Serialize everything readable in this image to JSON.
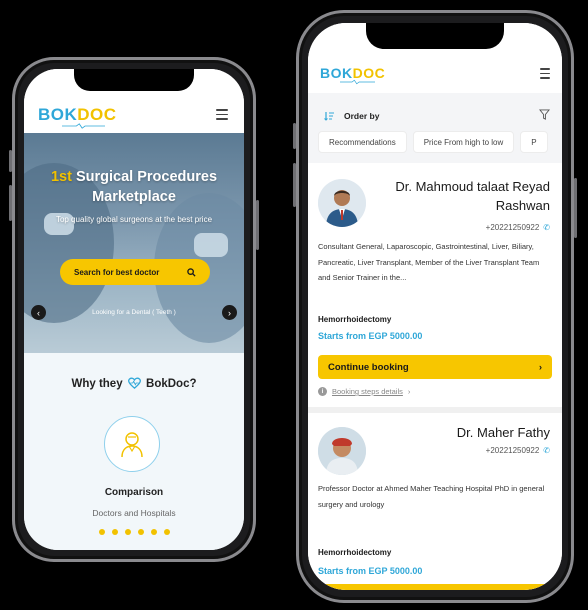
{
  "brand": {
    "part1": "BOK",
    "part2": "DOC",
    "primary_color": "#2fa7d8",
    "accent_color": "#f2c200"
  },
  "left_screen": {
    "hero": {
      "title_accent": "1st",
      "title_line1_rest": " Surgical Procedures",
      "title_line2": "Marketplace",
      "subtitle": "Top quality global surgeons at the best price",
      "search_button": "Search for best doctor",
      "footer_text": "Looking for a Dental ( Teeth )"
    },
    "why": {
      "title_prefix": "Why they",
      "title_brand": "BokDoc?",
      "feature_title": "Comparison",
      "feature_subtitle": "Doctors and Hospitals",
      "carousel_dots": 6
    }
  },
  "right_screen": {
    "order_label": "Order by",
    "chips": [
      "Recommendations",
      "Price From high to low",
      "P"
    ],
    "doctors": [
      {
        "name": "Dr. Mahmoud talaat Reyad Rashwan",
        "phone": "+20221250922",
        "description": "Consultant General, Laparoscopic, Gastrointestinal, Liver, Biliary, Pancreatic, Liver Transplant, Member of the Liver Transplant Team and Senior Trainer in the...",
        "procedure": "Hemorrhoidectomy",
        "price": "Starts from EGP 5000.00",
        "button": "Continue booking",
        "steps_link": "Booking steps details"
      },
      {
        "name": "Dr. Maher Fathy",
        "phone": "+20221250922",
        "description": "Professor Doctor at Ahmed Maher Teaching Hospital PhD in general surgery and urology",
        "procedure": "Hemorrhoidectomy",
        "price": "Starts from EGP 5000.00"
      }
    ]
  },
  "icons": [
    "hamburger-icon",
    "search-icon",
    "chevron-left-icon",
    "chevron-right-icon",
    "heart-icon",
    "doctor-icon",
    "sort-icon",
    "filter-icon",
    "phone-icon",
    "info-icon"
  ]
}
